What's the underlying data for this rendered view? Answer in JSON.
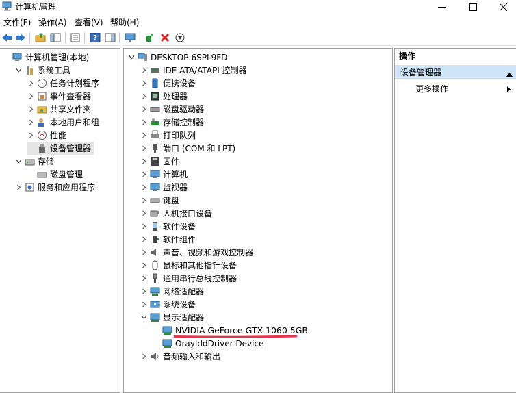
{
  "window": {
    "title": "计算机管理"
  },
  "menu": [
    {
      "label": "文件(F)"
    },
    {
      "label": "操作(A)"
    },
    {
      "label": "查看(V)"
    },
    {
      "label": "帮助(H)"
    }
  ],
  "toolbar": {
    "icons": [
      "back-arrow-icon",
      "forward-arrow-icon",
      "up-folder-icon",
      "show-hide-tree-icon",
      "properties-icon",
      "help-icon",
      "show-action-pane-icon",
      "monitor-icon",
      "scan-hardware-icon",
      "uninstall-icon",
      "disable-device-icon"
    ]
  },
  "left_tree": [
    {
      "label": "计算机管理(本地)",
      "level": 0,
      "expander": "none",
      "icon": "computer-management-icon"
    },
    {
      "label": "系统工具",
      "level": 1,
      "expander": "expanded",
      "icon": "system-tools-icon"
    },
    {
      "label": "任务计划程序",
      "level": 2,
      "expander": "collapsed",
      "icon": "task-scheduler-icon"
    },
    {
      "label": "事件查看器",
      "level": 2,
      "expander": "collapsed",
      "icon": "event-viewer-icon"
    },
    {
      "label": "共享文件夹",
      "level": 2,
      "expander": "collapsed",
      "icon": "shared-folders-icon"
    },
    {
      "label": "本地用户和组",
      "level": 2,
      "expander": "collapsed",
      "icon": "local-users-icon"
    },
    {
      "label": "性能",
      "level": 2,
      "expander": "collapsed",
      "icon": "performance-icon"
    },
    {
      "label": "设备管理器",
      "level": 2,
      "expander": "none",
      "icon": "device-manager-icon",
      "selected": true
    },
    {
      "label": "存储",
      "level": 1,
      "expander": "expanded",
      "icon": "storage-icon"
    },
    {
      "label": "磁盘管理",
      "level": 2,
      "expander": "none",
      "icon": "disk-management-icon"
    },
    {
      "label": "服务和应用程序",
      "level": 1,
      "expander": "collapsed",
      "icon": "services-apps-icon"
    }
  ],
  "device_tree": [
    {
      "label": "DESKTOP-6SPL9FD",
      "level": 0,
      "expander": "expanded",
      "icon": "computer-icon"
    },
    {
      "label": "IDE ATA/ATAPI 控制器",
      "level": 1,
      "expander": "collapsed",
      "icon": "ide-controller-icon"
    },
    {
      "label": "便携设备",
      "level": 1,
      "expander": "collapsed",
      "icon": "portable-device-icon"
    },
    {
      "label": "处理器",
      "level": 1,
      "expander": "collapsed",
      "icon": "processor-icon"
    },
    {
      "label": "磁盘驱动器",
      "level": 1,
      "expander": "collapsed",
      "icon": "disk-drive-icon"
    },
    {
      "label": "存储控制器",
      "level": 1,
      "expander": "collapsed",
      "icon": "storage-controller-icon"
    },
    {
      "label": "打印队列",
      "level": 1,
      "expander": "collapsed",
      "icon": "printer-icon"
    },
    {
      "label": "端口 (COM 和 LPT)",
      "level": 1,
      "expander": "collapsed",
      "icon": "port-icon"
    },
    {
      "label": "固件",
      "level": 1,
      "expander": "collapsed",
      "icon": "firmware-icon"
    },
    {
      "label": "计算机",
      "level": 1,
      "expander": "collapsed",
      "icon": "monitor-icon"
    },
    {
      "label": "监视器",
      "level": 1,
      "expander": "collapsed",
      "icon": "monitor-icon"
    },
    {
      "label": "键盘",
      "level": 1,
      "expander": "collapsed",
      "icon": "keyboard-icon"
    },
    {
      "label": "人机接口设备",
      "level": 1,
      "expander": "collapsed",
      "icon": "hid-icon"
    },
    {
      "label": "软件设备",
      "level": 1,
      "expander": "collapsed",
      "icon": "software-device-icon"
    },
    {
      "label": "软件组件",
      "level": 1,
      "expander": "collapsed",
      "icon": "software-component-icon"
    },
    {
      "label": "声音、视频和游戏控制器",
      "level": 1,
      "expander": "collapsed",
      "icon": "sound-icon"
    },
    {
      "label": "鼠标和其他指针设备",
      "level": 1,
      "expander": "collapsed",
      "icon": "mouse-icon"
    },
    {
      "label": "通用串行总线控制器",
      "level": 1,
      "expander": "collapsed",
      "icon": "usb-icon"
    },
    {
      "label": "网络适配器",
      "level": 1,
      "expander": "collapsed",
      "icon": "network-adapter-icon"
    },
    {
      "label": "系统设备",
      "level": 1,
      "expander": "collapsed",
      "icon": "system-device-icon"
    },
    {
      "label": "显示适配器",
      "level": 1,
      "expander": "expanded",
      "icon": "display-adapter-icon"
    },
    {
      "label": "NVIDIA GeForce GTX 1060 5GB",
      "level": 2,
      "expander": "none",
      "icon": "display-adapter-icon",
      "emphasis": true
    },
    {
      "label": "OrayIddDriver Device",
      "level": 2,
      "expander": "none",
      "icon": "display-adapter-icon"
    },
    {
      "label": "音频输入和输出",
      "level": 1,
      "expander": "collapsed",
      "icon": "audio-icon"
    }
  ],
  "actions": {
    "header": "操作",
    "section": "设备管理器",
    "more": "更多操作"
  },
  "colors": {
    "accent": "#cfe5f7",
    "highlight_mark": "#e2364f",
    "selected": "#e5e5e5"
  }
}
